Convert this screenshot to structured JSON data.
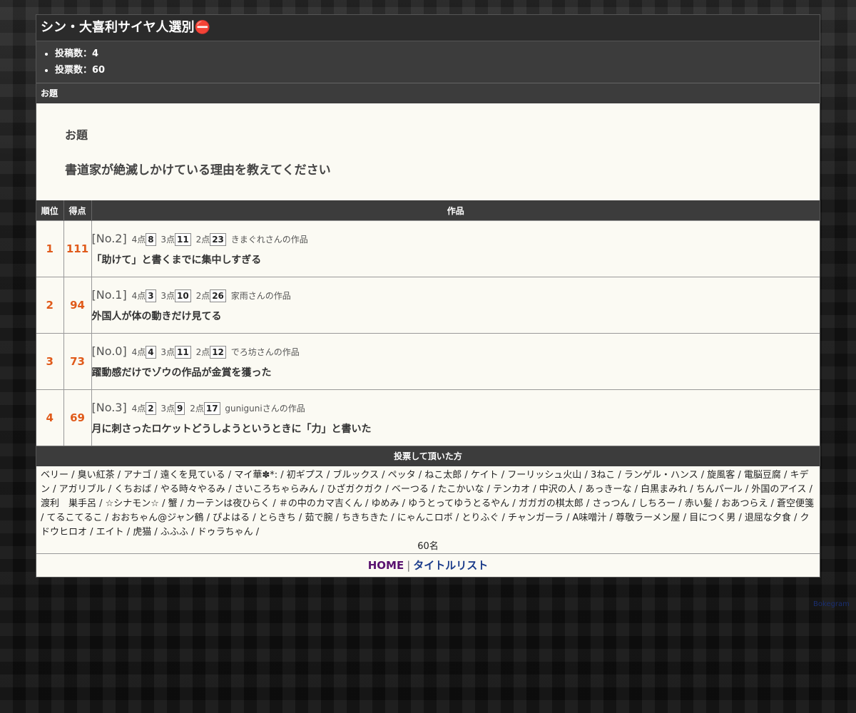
{
  "page": {
    "title": "シン・大喜利サイヤ人選別⛔"
  },
  "stats": [
    {
      "label": "投稿数：4"
    },
    {
      "label": "投票数：60"
    }
  ],
  "odai_section": {
    "heading": "お題",
    "label": "お題",
    "text": "書道家が絶滅しかけている理由を教えてください"
  },
  "ranking": {
    "headers": {
      "rank": "順位",
      "score": "得点",
      "work": "作品"
    },
    "rows": [
      {
        "rank": "1",
        "score": "111",
        "no": "[No.2]",
        "p4_label": "4点",
        "p4": "8",
        "p3_label": "3点",
        "p3": "11",
        "p2_label": "2点",
        "p2": "23",
        "author": "きまぐれさんの作品",
        "text": "「助けて」と書くまでに集中しすぎる"
      },
      {
        "rank": "2",
        "score": "94",
        "no": "[No.1]",
        "p4_label": "4点",
        "p4": "3",
        "p3_label": "3点",
        "p3": "10",
        "p2_label": "2点",
        "p2": "26",
        "author": "家雨さんの作品",
        "text": "外国人が体の動きだけ見てる"
      },
      {
        "rank": "3",
        "score": "73",
        "no": "[No.0]",
        "p4_label": "4点",
        "p4": "4",
        "p3_label": "3点",
        "p3": "11",
        "p2_label": "2点",
        "p2": "12",
        "author": "でろ坊さんの作品",
        "text": "躍動感だけでゾウの作品が金賞を獲った"
      },
      {
        "rank": "4",
        "score": "69",
        "no": "[No.3]",
        "p4_label": "4点",
        "p4": "2",
        "p3_label": "3点",
        "p3": "9",
        "p2_label": "2点",
        "p2": "17",
        "author": "guniguniさんの作品",
        "text": "月に刺さったロケットどうしようというときに「力」と書いた"
      }
    ]
  },
  "voters": {
    "heading": "投票して頂いた方",
    "list": "ベリー / 臭い紅茶 / アナゴ / 遠くを見ている / マイ華✽*: / 初ギプス / ブルックス / ペッタ / ねこ太郎 / ケイト / フーリッシュ火山 / 3ねこ / ランゲル・ハンス / 旋風客 / 電脳豆腐 / キデン / アガリブル / くちおば / やる時々やるみ / さいころちゃらみん / ひざガクガク / ベーつる / たこかいな / テンカオ / 中沢の人 / あっきーな / 白黒まみれ / ちんパール / 外国のアイス / 渡利　巣手呂 / ☆シナモン☆ / 蟹 / カーテンは夜ひらく / ＃の中のカマ吉くん / ゆめみ / ゆうとってゆうとるやん / ガガガの棋太郎 / さっつん / しちろー / 赤い髪 / おあつらえ / 蒼空便箋 / てるこてるこ / おおちゃん@ジャン鶴 / ぴよはる / とらきち / 茹で腕 / ちきちきた / にゃんこロボ / とりふぐ / チャンガーラ / A味噌汁 / 尊敬ラーメン屋 / 目につく男 / 退屈な夕食 / クドウヒロオ / エイト / 虎猫 / ふふふ / ドゥラちゃん /",
    "count": "60名"
  },
  "footer": {
    "home": "HOME",
    "separator": "|",
    "title_list": "タイトルリスト"
  },
  "credit": "Bokegram"
}
